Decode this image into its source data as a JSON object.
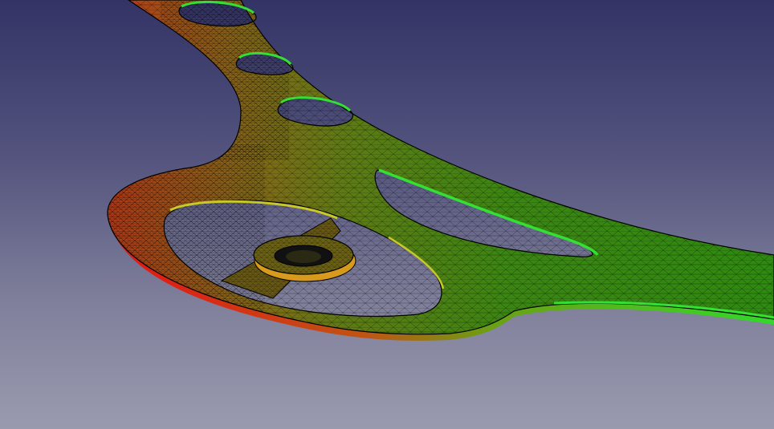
{
  "viewport": {
    "background_top": "#333366",
    "background_bottom": "#9a9aaf"
  },
  "mesh": {
    "edge_color": "#000000",
    "colormap": [
      "#e01c14",
      "#a7581a",
      "#5f7e14",
      "#2f8a10",
      "#2db51c",
      "#33e033"
    ],
    "highlight_color": "#33e033",
    "hot_color": "#e01c14",
    "warm_color": "#e08a14"
  }
}
